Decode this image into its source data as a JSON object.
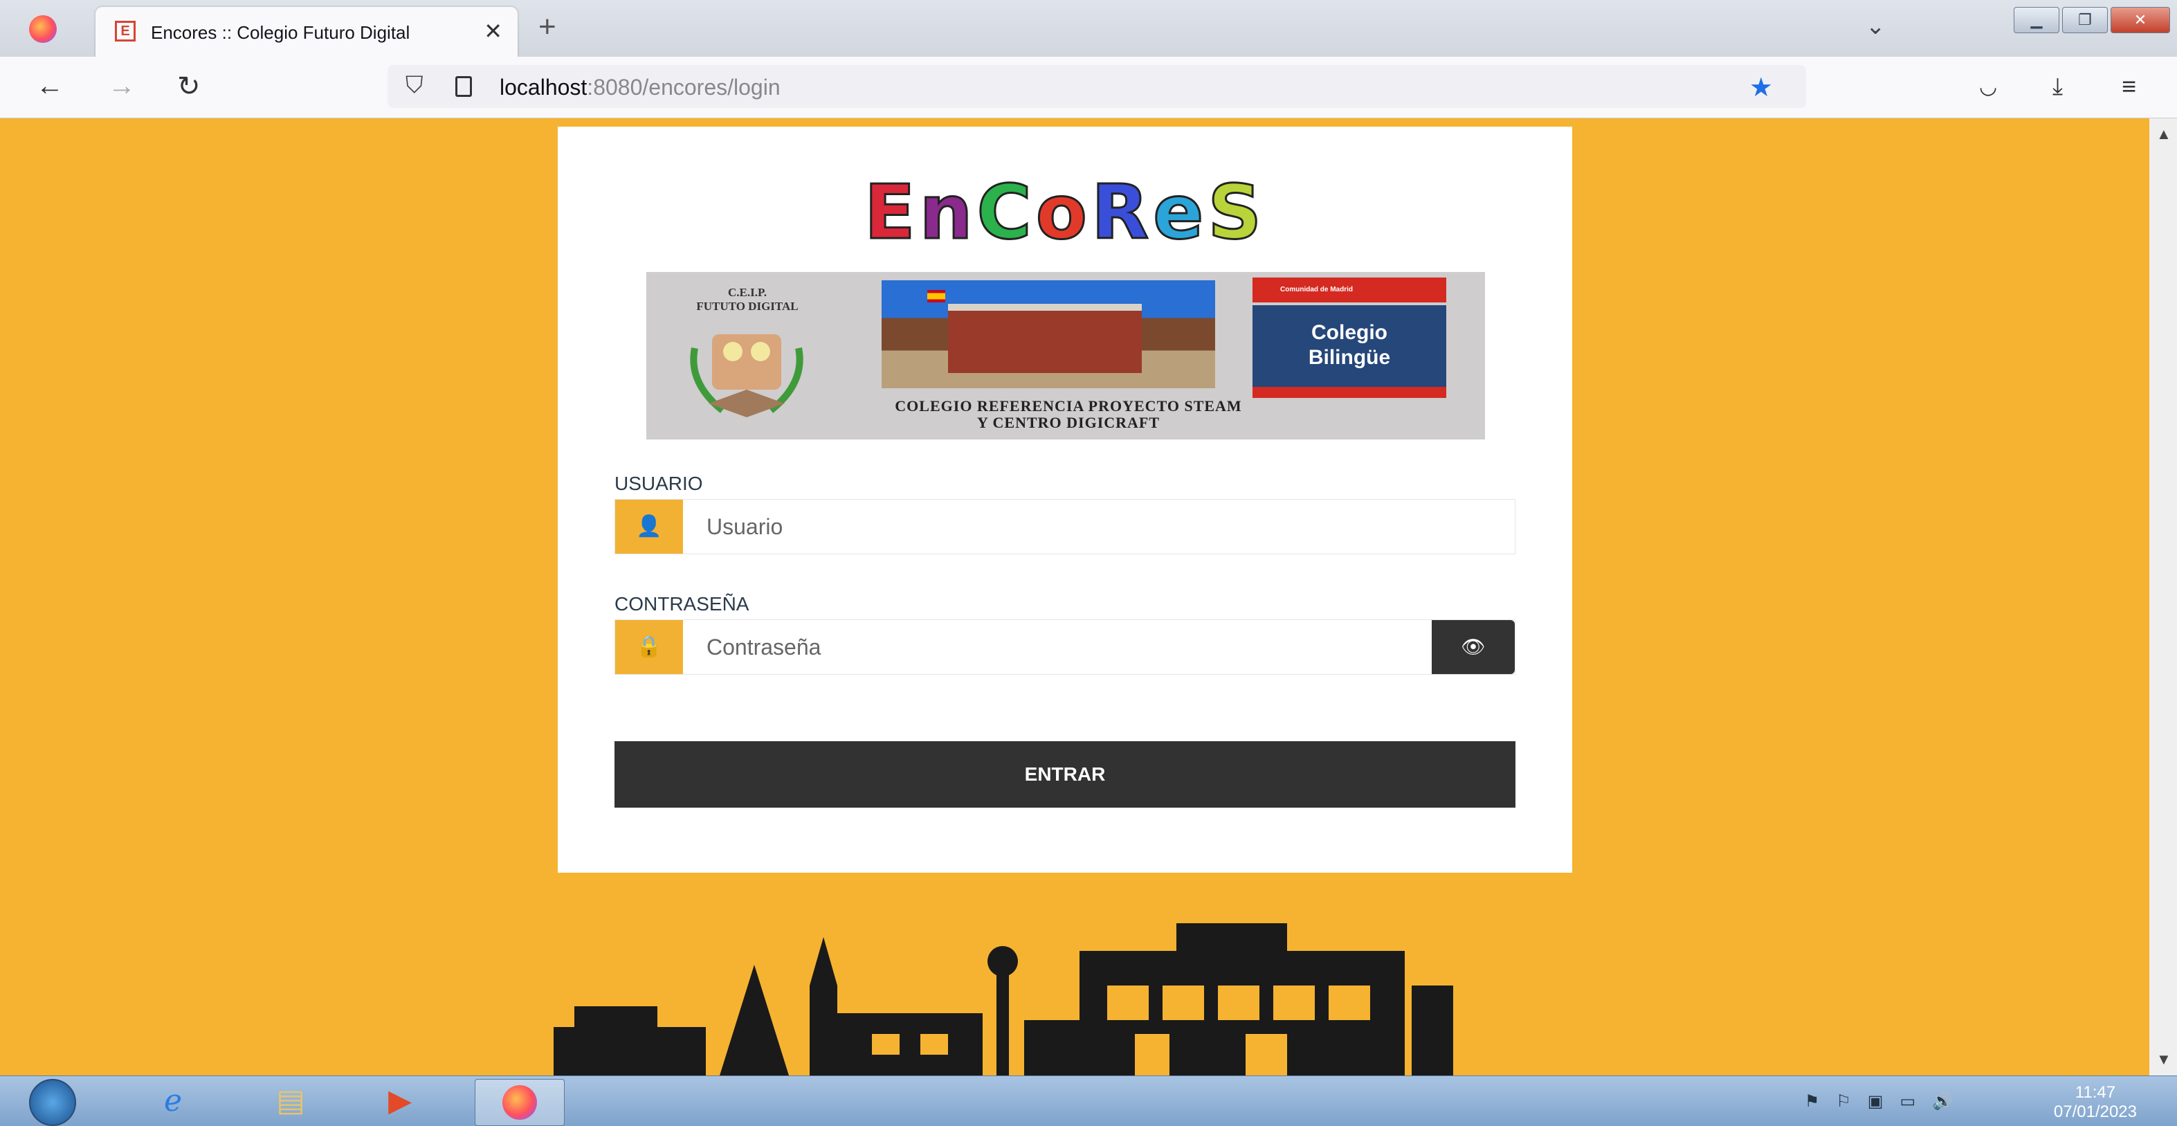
{
  "browser": {
    "tab_title": "Encores :: Colegio Futuro Digital",
    "tab_favicon": "E",
    "new_tab": "+",
    "url_host": "localhost",
    "url_path": ":8080/encores/login"
  },
  "brand": {
    "letters": [
      "E",
      "n",
      "C",
      "o",
      "R",
      "e",
      "S"
    ],
    "colors": [
      "#d9283a",
      "#8a2a8c",
      "#2bb24c",
      "#e23a2a",
      "#3a4fd9",
      "#2ba5d9",
      "#b8d43a"
    ]
  },
  "banner": {
    "school": "C.E.I.P.\nFUTUTO DIGITAL",
    "motto": "COLEGIO REFERENCIA PROYECTO STEAM\nY CENTRO DIGICRAFT",
    "madrid": "Comunidad de Madrid",
    "bilingual": "Colegio\nBilingüe"
  },
  "form": {
    "user_label": "USUARIO",
    "user_placeholder": "Usuario",
    "password_label": "CONTRASEÑA",
    "password_placeholder": "Contraseña",
    "submit_label": "ENTRAR"
  },
  "taskbar": {
    "time": "11:47",
    "date": "07/01/2023"
  },
  "colors": {
    "page_background": "#f5b331",
    "addon": "#f2b132",
    "button": "#323232"
  }
}
